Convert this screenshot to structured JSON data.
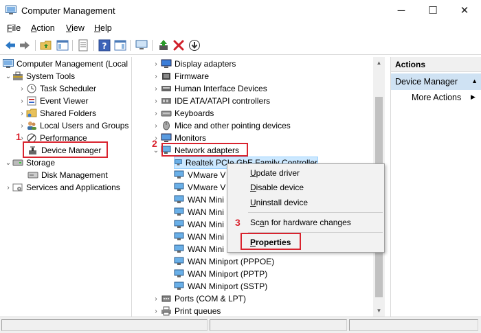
{
  "window": {
    "title": "Computer Management",
    "minimize_glyph": "─",
    "maximize_glyph": "☐",
    "close_glyph": "✕"
  },
  "menu": {
    "file_ul": "F",
    "file_rest": "ile",
    "action_ul": "A",
    "action_rest": "ction",
    "view_ul": "V",
    "view_rest": "iew",
    "help_ul": "H",
    "help_rest": "elp"
  },
  "tree": {
    "root": "Computer Management (Local",
    "system_tools": "System Tools",
    "task_scheduler": "Task Scheduler",
    "event_viewer": "Event Viewer",
    "shared_folders": "Shared Folders",
    "local_users": "Local Users and Groups",
    "performance": "Performance",
    "device_manager": "Device Manager",
    "storage": "Storage",
    "disk_management": "Disk Management",
    "services_apps": "Services and Applications"
  },
  "devices": {
    "display_adapters": "Display adapters",
    "firmware": "Firmware",
    "hid": "Human Interface Devices",
    "ide": "IDE ATA/ATAPI controllers",
    "keyboards": "Keyboards",
    "mice": "Mice and other pointing devices",
    "monitors": "Monitors",
    "network_adapters": "Network adapters",
    "adapters": [
      "Realtek PCIe GbE Family Controller",
      "VMware V",
      "VMware V",
      "WAN Mini",
      "WAN Mini",
      "WAN Mini",
      "WAN Mini",
      "WAN Mini",
      "WAN Miniport (PPPOE)",
      "WAN Miniport (PPTP)",
      "WAN Miniport (SSTP)"
    ],
    "ports": "Ports (COM & LPT)",
    "print_queues": "Print queues"
  },
  "context_menu": {
    "update_ul": "U",
    "update_rest": "pdate driver",
    "disable_ul": "D",
    "disable_rest": "isable device",
    "uninstall_ul": "U",
    "uninstall_rest": "ninstall device",
    "scan_pre": "Sc",
    "scan_ul": "a",
    "scan_rest": "n for hardware changes",
    "properties_ul": "P",
    "properties_rest": "roperties"
  },
  "actions": {
    "header": "Actions",
    "section": "Device Manager",
    "more_actions": "More Actions"
  },
  "annotations": {
    "step1": "1",
    "step2": "2",
    "step3": "3"
  },
  "colors": {
    "annotation_red": "#d9232e",
    "selection_blue": "#cce8ff",
    "actions_section": "#cfe2f3"
  },
  "icons": {
    "arrow_collapsed": "›",
    "arrow_expanded": "⌄"
  }
}
